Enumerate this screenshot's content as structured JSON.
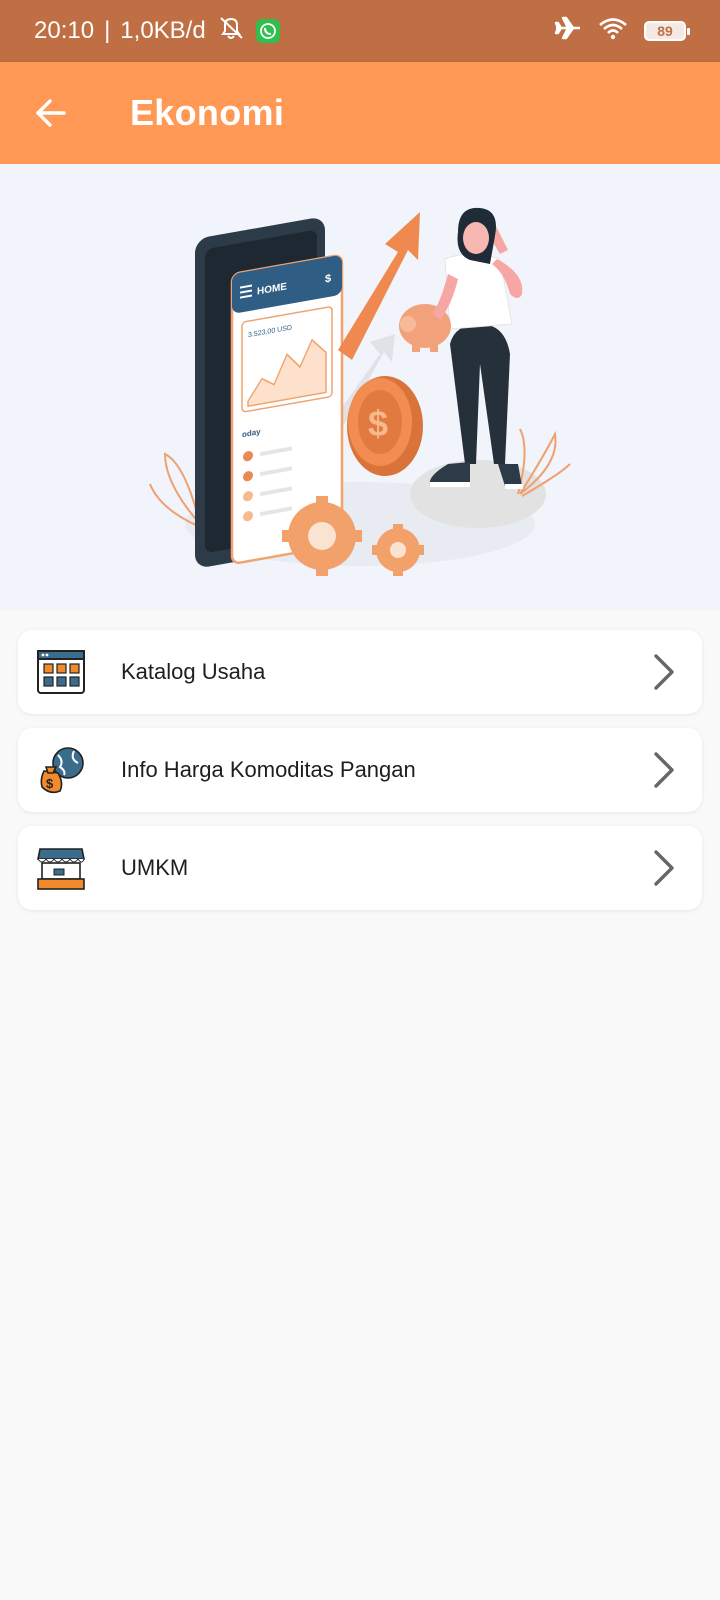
{
  "status_bar": {
    "time": "20:10",
    "separator": "|",
    "network_speed": "1,0KB/d",
    "battery_level": "89",
    "icons": [
      "mute-notification-icon",
      "whatsapp-icon",
      "airplane-mode-icon",
      "wifi-icon",
      "battery-icon"
    ]
  },
  "app_bar": {
    "title": "Ekonomi",
    "back_icon": "arrow-left-icon",
    "background_color": "#ff9955"
  },
  "hero": {
    "illustration": "finance-growth-illustration",
    "phone_screen_header": "HOME",
    "phone_screen_currency_icon": "$",
    "phone_screen_amount": "3.523,00 USD",
    "phone_screen_list_header": "oday"
  },
  "menu": {
    "items": [
      {
        "label": "Katalog Usaha",
        "icon": "catalog-grid-icon"
      },
      {
        "label": "Info Harga Komoditas Pangan",
        "icon": "money-globe-icon"
      },
      {
        "label": "UMKM",
        "icon": "market-stall-icon"
      }
    ],
    "chevron_icon": "chevron-right-icon"
  },
  "colors": {
    "status_bar": "#bf6f43",
    "accent": "#ff9955",
    "background": "#f9f9f9",
    "card": "#ffffff"
  }
}
